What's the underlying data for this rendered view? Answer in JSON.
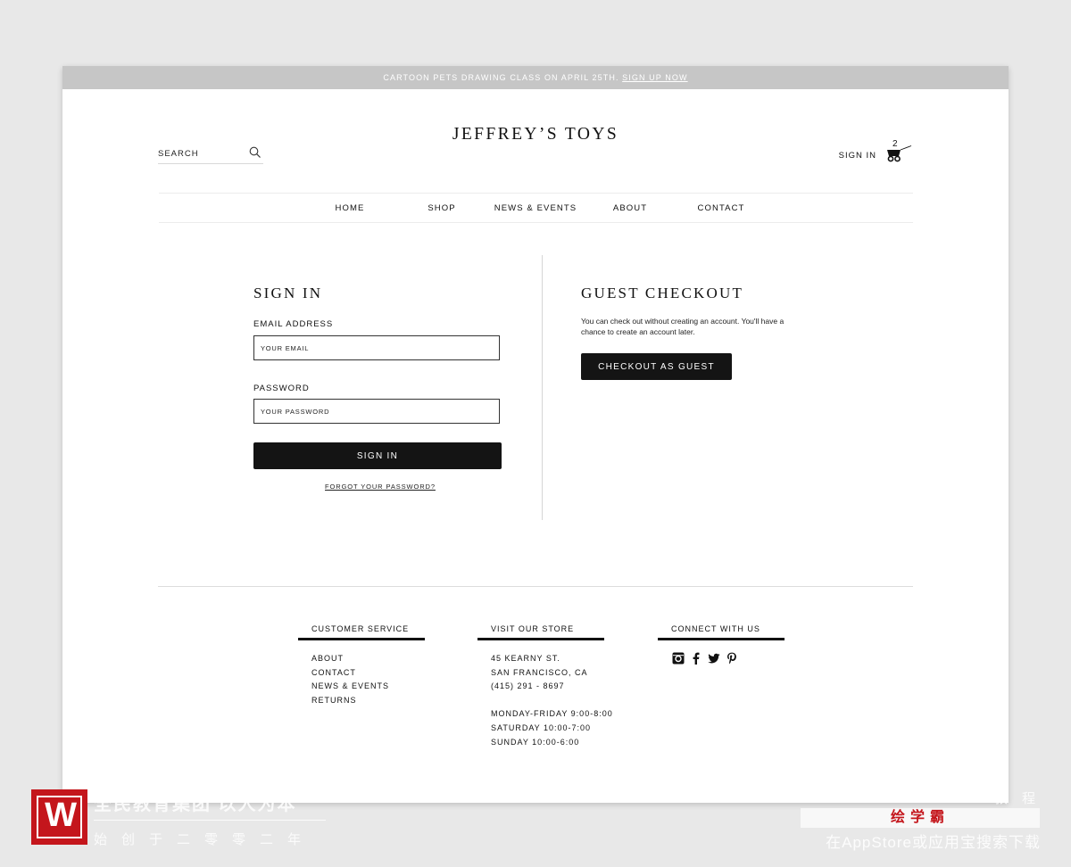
{
  "promo": {
    "text": "CARTOON PETS DRAWING CLASS ON APRIL 25TH.",
    "link": "SIGN UP NOW"
  },
  "header": {
    "search_placeholder": "SEARCH",
    "logo": "JEFFREY’S TOYS",
    "signin": "SIGN IN",
    "cart_count": "2"
  },
  "nav": [
    "HOME",
    "SHOP",
    "NEWS & EVENTS",
    "ABOUT",
    "CONTACT"
  ],
  "signin": {
    "title": "SIGN IN",
    "email_label": "EMAIL ADDRESS",
    "email_placeholder": "YOUR EMAIL",
    "password_label": "PASSWORD",
    "password_placeholder": "YOUR PASSWORD",
    "button": "SIGN IN",
    "forgot": "FORGOT YOUR PASSWORD?"
  },
  "guest": {
    "title": "GUEST CHECKOUT",
    "text": "You can check out without creating an account. You'll have a chance to create an account later.",
    "button": "CHECKOUT AS GUEST"
  },
  "footer": {
    "customer_service": {
      "title": "CUSTOMER SERVICE",
      "links": [
        "ABOUT",
        "CONTACT",
        "NEWS & EVENTS",
        "RETURNS"
      ]
    },
    "store": {
      "title": "VISIT OUR STORE",
      "address": [
        "45 KEARNY ST.",
        "SAN FRANCISCO, CA",
        "(415) 291 - 8697"
      ],
      "hours": [
        "MONDAY-FRIDAY 9:00-8:00",
        "SATURDAY 10:00-7:00",
        "SUNDAY 10:00-6:00"
      ]
    },
    "connect": {
      "title": "CONNECT WITH US",
      "icons": [
        "instagram-icon",
        "facebook-icon",
        "twitter-icon",
        "pinterest-icon"
      ]
    }
  },
  "watermark": {
    "line1": "全民教育集团 以人为本",
    "line2": "始创于二零零二年",
    "right1": "教 程",
    "brand": "绘学霸",
    "right2": "在AppStore或应用宝搜索下载"
  },
  "colors": {
    "button": "#141414",
    "promo_bar": "#c6c6c6",
    "background": "#e8e8e8"
  }
}
